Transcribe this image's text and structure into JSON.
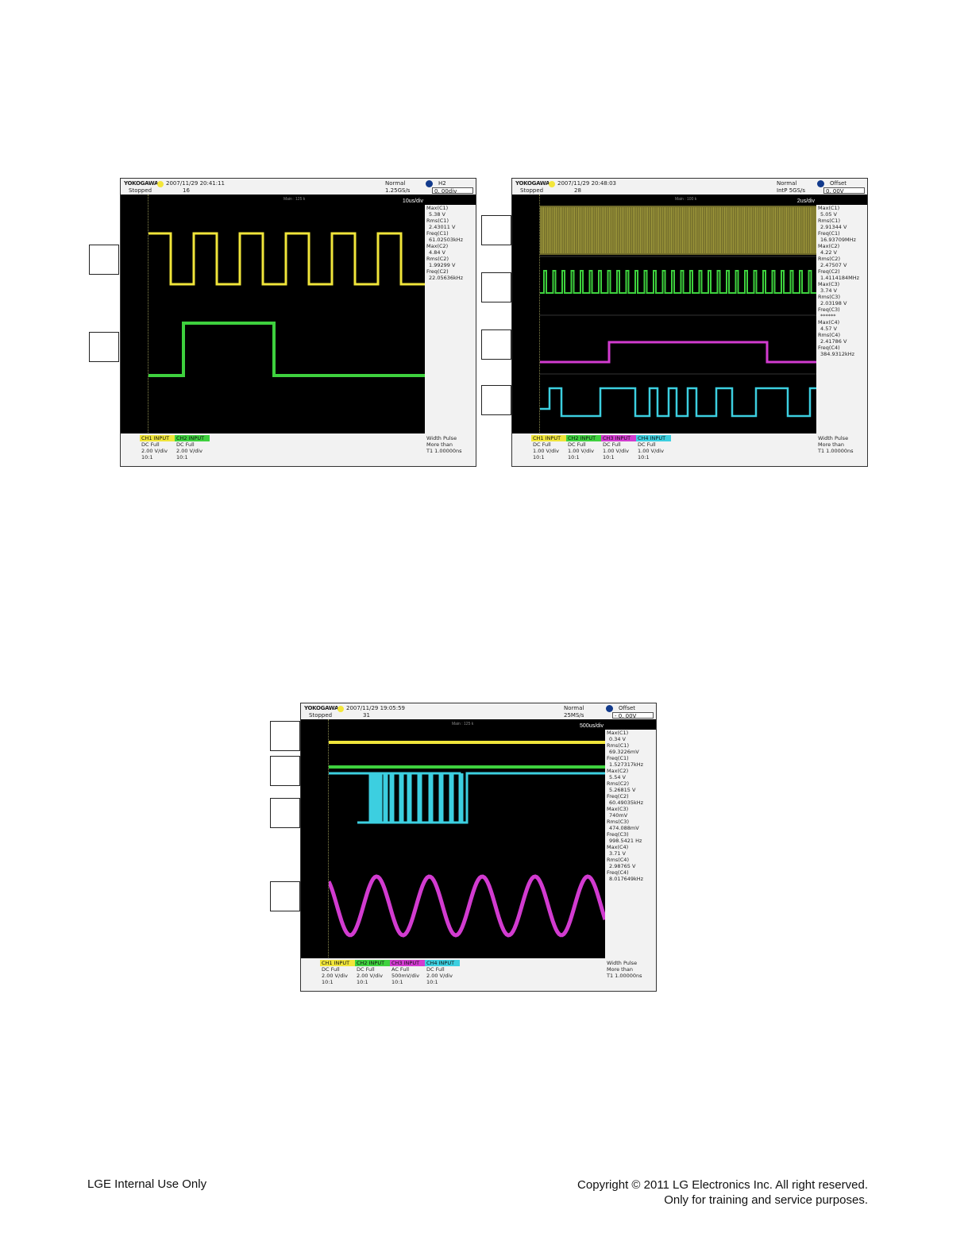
{
  "scopes": [
    {
      "id": "scope-1",
      "brand": "YOKOGAWA",
      "datetime": "2007/11/29 20:41:11",
      "status": "Stopped",
      "count": "16",
      "mode": "Normal",
      "rate": "1.25GS/s",
      "knob_label": "H2",
      "knob_value": "0. 00div",
      "main_label": "Main : 125 k",
      "timebase": "10us/div",
      "measurements": [
        "Max(C1)",
        "5.38 V",
        "Rms(C1)",
        "2.43011 V",
        "Freq(C1)",
        "61.02503kHz",
        "Max(C2)",
        "4.84 V",
        "Rms(C2)",
        "1.99299 V",
        "Freq(C2)",
        "22.05636kHz"
      ],
      "channels": [
        {
          "label": "CH1  INPUT",
          "color": "#f0e53a",
          "l1": "DC Full",
          "l2": "2.00 V/div",
          "l3": "10:1"
        },
        {
          "label": "CH2  INPUT",
          "color": "#3ed13e",
          "l1": "DC Full",
          "l2": "2.00 V/div",
          "l3": "10:1"
        }
      ],
      "trigger": [
        "Width Pulse",
        "More than",
        "T1  1.00000ns"
      ]
    },
    {
      "id": "scope-2",
      "brand": "YOKOGAWA",
      "datetime": "2007/11/29 20:48:03",
      "status": "Stopped",
      "count": "28",
      "mode": "Normal",
      "rate": "IntP  5GS/s",
      "knob_label": "Offset",
      "knob_value": "0. 00V",
      "main_label": "Main : 100 k",
      "timebase": "2us/div",
      "measurements": [
        "Max(C1)",
        "5.05 V",
        "Rms(C1)",
        "2.91344 V",
        "Freq(C1)",
        "16.93709MHz",
        "Max(C2)",
        "4.22 V",
        "Rms(C2)",
        "2.47507 V",
        "Freq(C2)",
        "1.4114184MHz",
        "Max(C3)",
        "3.74 V",
        "Rms(C3)",
        "2.03198 V",
        "Freq(C3)",
        "******",
        "Max(C4)",
        "4.57 V",
        "Rms(C4)",
        "2.41786 V",
        "Freq(C4)",
        "384.9312kHz"
      ],
      "channels": [
        {
          "label": "CH1  INPUT",
          "color": "#f0e53a",
          "l1": "DC Full",
          "l2": "1.00 V/div",
          "l3": "10:1"
        },
        {
          "label": "CH2  INPUT",
          "color": "#3ed13e",
          "l1": "DC Full",
          "l2": "1.00 V/div",
          "l3": "10:1"
        },
        {
          "label": "CH3  INPUT",
          "color": "#d23bd0",
          "l1": "DC Full",
          "l2": "1.00 V/div",
          "l3": "10:1"
        },
        {
          "label": "CH4  INPUT",
          "color": "#3ccfe0",
          "l1": "DC Full",
          "l2": "1.00 V/div",
          "l3": "10:1"
        }
      ],
      "trigger": [
        "Width Pulse",
        "More than",
        "T1  1.00000ns"
      ]
    },
    {
      "id": "scope-3",
      "brand": "YOKOGAWA",
      "datetime": "2007/11/29 19:05:59",
      "status": "Stopped",
      "count": "31",
      "mode": "Normal",
      "rate": "25MS/s",
      "knob_label": "Offset",
      "knob_value": "-  0. 00V",
      "main_label": "Main : 125 k",
      "timebase": "500us/div",
      "measurements": [
        "Max(C1)",
        "0.34 V",
        "Rms(C1)",
        "69.3226mV",
        "Freq(C1)",
        "1.527317kHz",
        "Max(C2)",
        "5.54 V",
        "Rms(C2)",
        "5.26815 V",
        "Freq(C2)",
        "60.49035kHz",
        "Max(C3)",
        "740mV",
        "Rms(C3)",
        "474.088mV",
        "Freq(C3)",
        "998.5421 Hz",
        "Max(C4)",
        "3.71 V",
        "Rms(C4)",
        "2.98765 V",
        "Freq(C4)",
        "8.017649kHz"
      ],
      "channels": [
        {
          "label": "CH1  INPUT",
          "color": "#f0e53a",
          "l1": "DC Full",
          "l2": "2.00 V/div",
          "l3": "10:1"
        },
        {
          "label": "CH2  INPUT",
          "color": "#3ed13e",
          "l1": "DC Full",
          "l2": "2.00 V/div",
          "l3": "10:1"
        },
        {
          "label": "CH3  INPUT",
          "color": "#d23bd0",
          "l1": "AC Full",
          "l2": "500mV/div",
          "l3": "10:1"
        },
        {
          "label": "CH4  INPUT",
          "color": "#3ccfe0",
          "l1": "DC Full",
          "l2": "2.00 V/div",
          "l3": "10:1"
        }
      ],
      "trigger": [
        "Width Pulse",
        "More than",
        "T1  1.00000ns"
      ]
    }
  ],
  "footer": {
    "left": "LGE Internal Use Only",
    "right_line1": "Copyright © 2011 LG Electronics Inc. All right reserved.",
    "right_line2": "Only for training and service purposes."
  },
  "colors": {
    "ch1": "#f0e53a",
    "ch2": "#3ed13e",
    "ch3": "#d23bd0",
    "ch4": "#3ccfe0"
  }
}
